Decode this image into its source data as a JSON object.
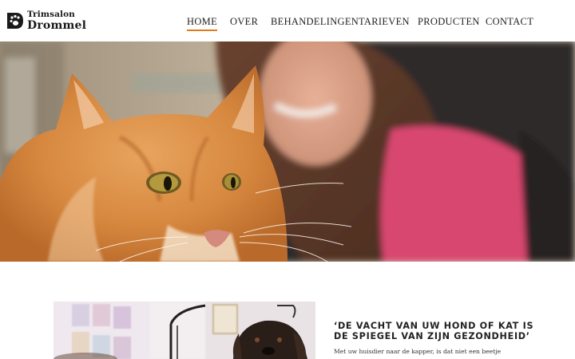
{
  "brand": {
    "line1": "Trimsalon",
    "line2": "Drommel"
  },
  "nav": {
    "items": [
      {
        "label": "HOME",
        "active": true
      },
      {
        "label": "OVER",
        "active": false
      },
      {
        "label": "BEHANDELINGEN",
        "active": false
      },
      {
        "label": "TARIEVEN",
        "active": false
      },
      {
        "label": "PRODUCTEN",
        "active": false
      },
      {
        "label": "CONTACT",
        "active": false
      }
    ],
    "accent_color": "#e07a1f"
  },
  "hero": {
    "image": "ginger-maine-coon-cat-with-groomer"
  },
  "intro": {
    "image": "dog-on-grooming-table",
    "heading_line1": "‘DE VACHT VAN UW HOND OF KAT IS",
    "heading_line2": "DE SPIEGEL VAN ZIJN GEZONDHEID’",
    "text": "Met uw huisdier naar de kapper, is dat niet een beetje"
  }
}
